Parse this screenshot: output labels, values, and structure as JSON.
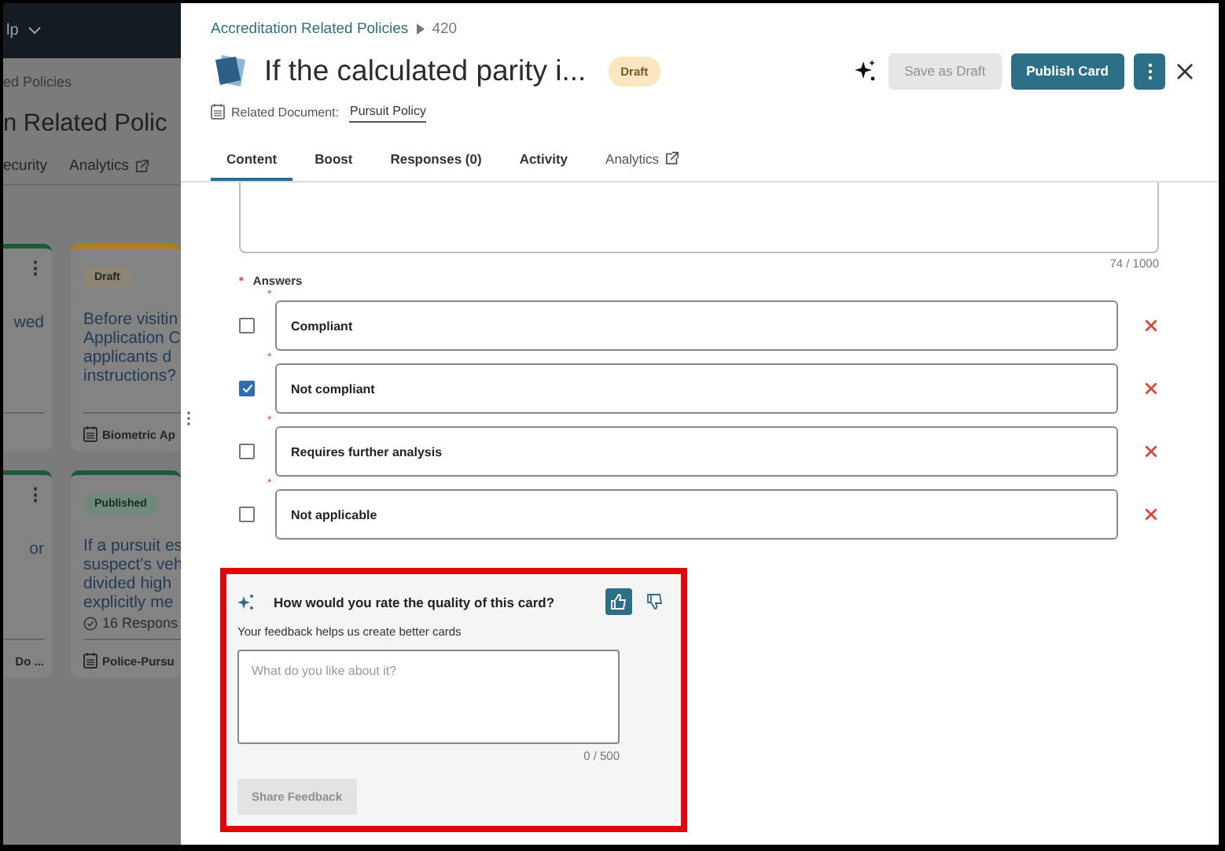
{
  "background": {
    "nav_label": "lp",
    "breadcrumb": "ed Policies",
    "title": "n Related Polic",
    "tabs": [
      {
        "label": "ecurity",
        "external": false
      },
      {
        "label": "Analytics",
        "external": true
      }
    ],
    "cards": [
      {
        "kind": "partial",
        "color": "#1d5a3c",
        "menu": "⋮",
        "lines": [
          "wed"
        ]
      },
      {
        "kind": "full",
        "color": "#b07f1a",
        "status": {
          "label": "Draft",
          "color": "#8f8572"
        },
        "lines": [
          "Before visitin",
          "Application C",
          "applicants d",
          "instructions?"
        ],
        "document": "Biometric Ap"
      },
      {
        "kind": "partial",
        "color": "#1d5a3c",
        "menu": "⋮",
        "lines": [
          "or"
        ],
        "footer": "Do ..."
      },
      {
        "kind": "full",
        "color": "#1d5a3c",
        "status": {
          "label": "Published",
          "color": "#6f8a7a"
        },
        "lines": [
          "If a pursuit es",
          "suspect's veh",
          "divided high",
          "explicitly me"
        ],
        "responses": "16 Respons",
        "document": "Police-Pursu"
      }
    ]
  },
  "drawer": {
    "handle": "⋮",
    "breadcrumb": {
      "parent": "Accreditation Related Policies",
      "id": "420"
    },
    "title": "If the calculated parity i...",
    "status": {
      "label": "Draft",
      "color": "#fbe7bf"
    },
    "save_draft": {
      "label": "Save as Draft",
      "disabled": true
    },
    "publish": {
      "label": "Publish Card"
    },
    "related_document": {
      "label": "Related Document:",
      "value": "Pursuit Policy"
    },
    "tabs": [
      {
        "label": "Content",
        "selected": true,
        "external": false
      },
      {
        "label": "Boost",
        "selected": false,
        "external": false
      },
      {
        "label": "Responses (0)",
        "selected": false,
        "external": false
      },
      {
        "label": "Activity",
        "selected": false,
        "external": false
      },
      {
        "label": "Analytics",
        "selected": false,
        "external": true
      }
    ]
  },
  "content": {
    "counter": "74 / 1000",
    "answers_marker": "*",
    "answers_label": "Answers",
    "answers": [
      {
        "marker": "*",
        "text": "Compliant",
        "checked": false
      },
      {
        "marker": "*",
        "text": "Not compliant",
        "checked": true
      },
      {
        "marker": "*",
        "text": "Requires further analysis",
        "checked": false
      },
      {
        "marker": "*",
        "text": "Not applicable",
        "checked": false
      }
    ]
  },
  "feedback": {
    "highlighted": true,
    "question": "How would you rate the quality of this card?",
    "thumbs_up": {
      "selected": true
    },
    "thumbs_down": {
      "selected": false
    },
    "subtitle": "Your feedback helps us create better cards",
    "placeholder": "What do you like about it?",
    "counter": "0 / 500",
    "button": {
      "label": "Share Feedback",
      "disabled": true
    }
  }
}
